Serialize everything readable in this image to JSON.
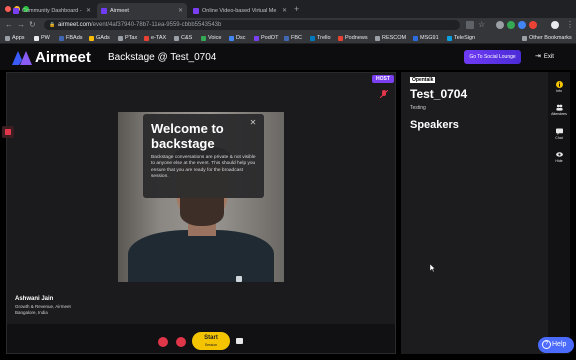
{
  "browser": {
    "tabs": [
      {
        "title": "Community Dashboard - Open",
        "active": false
      },
      {
        "title": "Airmeet",
        "active": true
      },
      {
        "title": "Online Video-based Virtual Me",
        "active": false
      }
    ],
    "url_host": "airmeet.com",
    "url_path": "/event/4af37940-78b7-11ea-9559-cbbb5543543b",
    "bookmarks": [
      "Apps",
      "PW",
      "FBAds",
      "GAds",
      "PTax",
      "e-TAX",
      "C&S",
      "Voice",
      "Dsc",
      "PodOT",
      "FBC",
      "Trello",
      "Podnews",
      "RESCOM",
      "MSG91",
      "TeleSign"
    ],
    "other_bookmarks": "Other Bookmarks"
  },
  "header": {
    "logo_text": "Airmeet",
    "title": "Backstage @ Test_0704",
    "social_button": "Go To Social Lounge",
    "exit_label": "Exit"
  },
  "stage": {
    "host_badge": "HOST",
    "welcome_title": "Welcome to backstage",
    "welcome_body": "Backstage conversations are private & not visible to anyone else at the event. This should help you ensure that you are ready for the broadcast session.",
    "speaker_name": "Ashwani Jain",
    "speaker_role": "Growth & Revenue, Airmeet",
    "speaker_location": "Bangalore, India",
    "start_label": "Start",
    "start_sub": "Session"
  },
  "panel": {
    "tag": "Opentalk",
    "event_title": "Test_0704",
    "event_desc": "Testing",
    "speakers_heading": "Speakers"
  },
  "rail": [
    {
      "label": "Info",
      "icon": "info-icon"
    },
    {
      "label": "Attendees",
      "icon": "attendees-icon"
    },
    {
      "label": "Chat",
      "icon": "chat-icon"
    },
    {
      "label": "Hide",
      "icon": "eye-icon"
    }
  ],
  "help_label": "Help",
  "colors": {
    "accent": "#7b3ff2",
    "start": "#f5c400",
    "help": "#4b6bff"
  }
}
